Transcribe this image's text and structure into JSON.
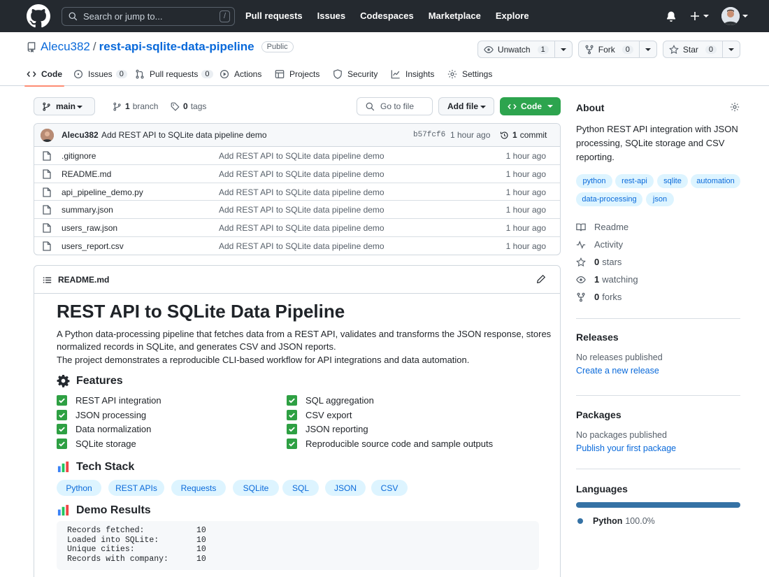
{
  "header": {
    "search_placeholder": "Search or jump to...",
    "search_shortcut": "/",
    "nav": [
      "Pull requests",
      "Issues",
      "Codespaces",
      "Marketplace",
      "Explore"
    ]
  },
  "repo": {
    "owner": "Alecu382",
    "separator": "/",
    "name": "rest-api-sqlite-data-pipeline",
    "visibility": "Public",
    "actions": {
      "watch_label": "Unwatch",
      "watch_count": "1",
      "fork_label": "Fork",
      "fork_count": "0",
      "star_label": "Star",
      "star_count": "0"
    },
    "tabs": [
      {
        "label": "Code",
        "count": ""
      },
      {
        "label": "Issues",
        "count": "0"
      },
      {
        "label": "Pull requests",
        "count": "0"
      },
      {
        "label": "Actions",
        "count": ""
      },
      {
        "label": "Projects",
        "count": ""
      },
      {
        "label": "Security",
        "count": ""
      },
      {
        "label": "Insights",
        "count": ""
      },
      {
        "label": "Settings",
        "count": ""
      }
    ]
  },
  "browser": {
    "branch": "main",
    "branches_count": "1",
    "branches_label": "branch",
    "tags_count": "0",
    "tags_label": "tags",
    "goto_label": "Go to file",
    "addfile_label": "Add file",
    "code_label": "Code",
    "commit": {
      "author": "Alecu382",
      "message": "Add REST API to SQLite data pipeline demo",
      "sha": "b57fcf6",
      "time": "1 hour ago",
      "count": "1",
      "count_label": "commit"
    },
    "files": [
      {
        "name": ".gitignore",
        "message": "Add REST API to SQLite data pipeline demo",
        "time": "1 hour ago"
      },
      {
        "name": "README.md",
        "message": "Add REST API to SQLite data pipeline demo",
        "time": "1 hour ago"
      },
      {
        "name": "api_pipeline_demo.py",
        "message": "Add REST API to SQLite data pipeline demo",
        "time": "1 hour ago"
      },
      {
        "name": "summary.json",
        "message": "Add REST API to SQLite data pipeline demo",
        "time": "1 hour ago"
      },
      {
        "name": "users_raw.json",
        "message": "Add REST API to SQLite data pipeline demo",
        "time": "1 hour ago"
      },
      {
        "name": "users_report.csv",
        "message": "Add REST API to SQLite data pipeline demo",
        "time": "1 hour ago"
      }
    ]
  },
  "readme": {
    "filename": "README.md",
    "title": "REST API to SQLite Data Pipeline",
    "intro": "A Python data-processing pipeline that fetches data from a REST API, validates and transforms the JSON response, stores normalized records in SQLite, and generates CSV and JSON reports.",
    "intro2": "The project demonstrates a reproducible CLI-based workflow for API integrations and data automation.",
    "features_heading": "Features",
    "features_left": [
      "REST API integration",
      "JSON processing",
      "Data normalization",
      "SQLite storage"
    ],
    "features_right": [
      "SQL aggregation",
      "CSV export",
      "JSON reporting",
      "Reproducible source code and sample outputs"
    ],
    "tech_heading": "Tech Stack",
    "tech": [
      "Python",
      "REST APIs",
      "Requests",
      "SQLite",
      "SQL",
      "JSON",
      "CSV"
    ],
    "demo_heading": "Demo Results",
    "demo": [
      {
        "label": "Records fetched:",
        "value": "10"
      },
      {
        "label": "Loaded into SQLite:",
        "value": "10"
      },
      {
        "label": "Unique cities:",
        "value": "10"
      },
      {
        "label": "Records with company:",
        "value": "10"
      }
    ]
  },
  "about": {
    "heading": "About",
    "description": "Python REST API integration with JSON processing, SQLite storage and CSV reporting.",
    "topics": [
      "python",
      "rest-api",
      "sqlite",
      "automation",
      "data-processing",
      "json"
    ],
    "readme_label": "Readme",
    "activity_label": "Activity",
    "stars_count": "0",
    "stars_label": "stars",
    "watching_count": "1",
    "watching_label": "watching",
    "forks_count": "0",
    "forks_label": "forks"
  },
  "releases": {
    "heading": "Releases",
    "text": "No releases published",
    "link": "Create a new release"
  },
  "packages": {
    "heading": "Packages",
    "text": "No packages published",
    "link": "Publish your first package"
  },
  "languages": {
    "heading": "Languages",
    "name": "Python",
    "percent": "100.0%",
    "share": 1.0,
    "color": "#3572A5"
  }
}
